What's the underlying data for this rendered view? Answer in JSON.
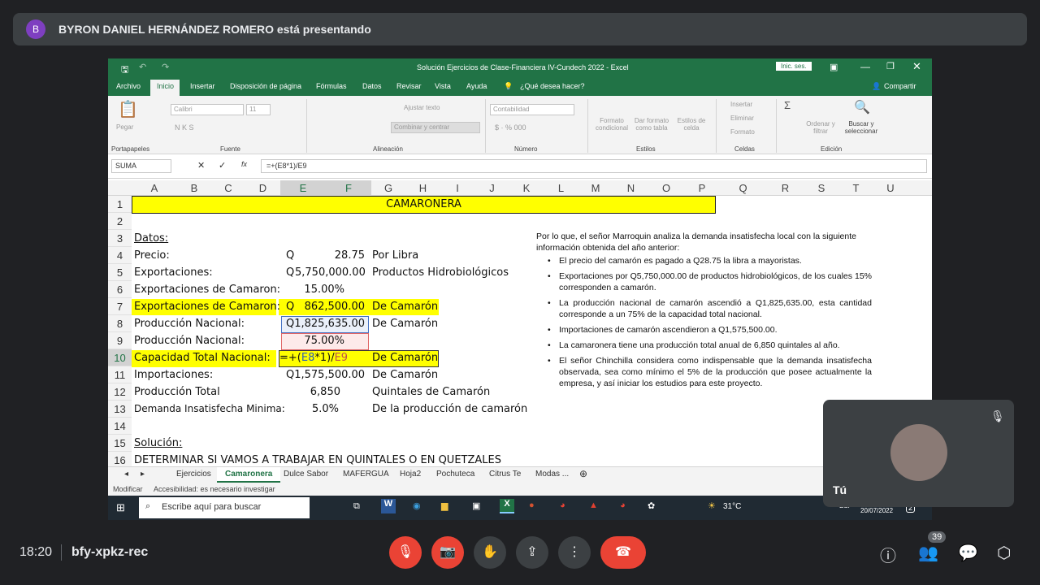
{
  "banner": {
    "avatar_letter": "B",
    "text": "BYRON DANIEL HERNÁNDEZ ROMERO está presentando"
  },
  "excel": {
    "title": "Solución Ejercicios de Clase-Financiera IV-Cundech 2022  -  Excel",
    "signin": "Inic. ses.",
    "tabs": [
      "Archivo",
      "Inicio",
      "Insertar",
      "Disposición de página",
      "Fórmulas",
      "Datos",
      "Revisar",
      "Vista",
      "Ayuda",
      "¿Qué desea hacer?"
    ],
    "share": "Compartir",
    "ribbon": {
      "paste": "Pegar",
      "font": "Calibri",
      "size": "11",
      "wrap": "Ajustar texto",
      "merge": "Combinar y centrar",
      "numfmt": "Contabilidad",
      "cond": "Formato condicional",
      "table": "Dar formato como tabla",
      "styles": "Estilos de celda",
      "insert": "Insertar",
      "delete": "Eliminar",
      "format": "Formato",
      "sort": "Ordenar y filtrar",
      "find": "Buscar y seleccionar",
      "groups": [
        "Portapapeles",
        "Fuente",
        "Alineación",
        "Número",
        "Estilos",
        "Celdas",
        "Edición"
      ]
    },
    "namebox": "SUMA",
    "formula": "=+(E8*1)/E9",
    "columns": [
      "A",
      "B",
      "C",
      "D",
      "E",
      "F",
      "G",
      "H",
      "I",
      "J",
      "K",
      "L",
      "M",
      "N",
      "O",
      "P",
      "Q",
      "R",
      "S",
      "T",
      "U"
    ],
    "rows": [
      "1",
      "2",
      "3",
      "4",
      "5",
      "6",
      "7",
      "8",
      "9",
      "10",
      "11",
      "12",
      "13",
      "14",
      "15",
      "16"
    ],
    "cells": {
      "r1": "CAMARONERA",
      "r3": "Datos:",
      "r4a": "Precio:",
      "r4q": "Q",
      "r4v": "28.75",
      "r4g": "Por Libra",
      "r5a": "Exportaciones:",
      "r5q": "Q",
      "r5v": "5,750,000.00",
      "r5g": "Productos Hidrobiológicos",
      "r6a": "Exportaciones de Camaron:",
      "r6v": "15.00%",
      "r7a": "Exportaciones de Camaron:",
      "r7q": "Q",
      "r7v": "862,500.00",
      "r7g": "De Camarón",
      "r8a": "Producción Nacional:",
      "r8v": "Q1,825,635.00",
      "r8g": "De Camarón",
      "r9a": "Producción Nacional:",
      "r9v": "75.00%",
      "r10a": "Capacidad Total Nacional:",
      "r10f1": "=+(",
      "r10f2": "E8",
      "r10f3": "*1)/",
      "r10f4": "E9",
      "r10g": "De Camarón",
      "r11a": "Importaciones:",
      "r11v": "Q1,575,500.00",
      "r11g": "De Camarón",
      "r12a": "Producción Total",
      "r12v": "6,850",
      "r12g": "Quintales de Camarón",
      "r13a": "Demanda Insatisfecha Minima:",
      "r13v": "5.0%",
      "r13g": "De la producción de camarón a",
      "r15a": "Solución:",
      "r16a": "DETERMINAR SI VAMOS A TRABAJAR EN QUINTALES O EN QUETZALES"
    },
    "notes": {
      "intro": "Por lo que, el señor Marroquin analiza la demanda insatisfecha local con la siguiente información obtenida del año anterior:",
      "bullets": [
        "El precio del camarón es pagado a Q28.75 la libra a mayoristas.",
        "Exportaciones por Q5,750,000.00 de productos hidrobiológicos, de los cuales 15% corresponden a camarón.",
        "La producción nacional de camarón ascendió a Q1,825,635.00, esta cantidad corresponde a un 75% de la capacidad total nacional.",
        "Importaciones de camarón ascendieron a Q1,575,500.00.",
        "La camaronera tiene una producción total anual de 6,850 quintales al año.",
        "El señor Chinchilla considera como indispensable que la demanda insatisfecha observada, sea como mínimo el 5% de la producción que posee actualmente la empresa, y así iniciar los estudios para este proyecto."
      ]
    },
    "sheets": [
      "Ejercicios",
      "Camaronera",
      "Dulce Sabor",
      "MAFERGUA",
      "Hoja2",
      "Pochuteca",
      "Citrus Te",
      "Modas ..."
    ],
    "status": {
      "mode": "Modificar",
      "access": "Accesibilidad: es necesario investigar"
    },
    "taskbar": {
      "search": "Escribe aquí para buscar",
      "temp": "31°C",
      "lang": "ESP",
      "date": "20/07/2022",
      "notif": "2"
    }
  },
  "selfview": {
    "label": "Tú"
  },
  "meet": {
    "time": "18:20",
    "code": "bfy-xpkz-rec",
    "participants": "39"
  }
}
